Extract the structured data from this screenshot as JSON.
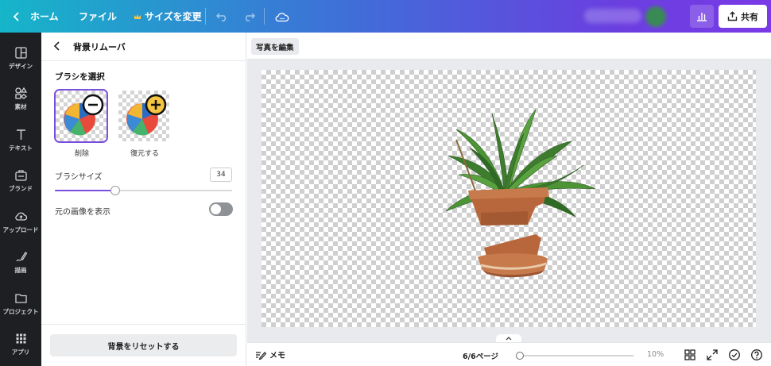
{
  "topbar": {
    "home_label": "ホーム",
    "file_label": "ファイル",
    "resize_label": "サイズを変更",
    "share_label": "共有"
  },
  "rail": {
    "items": [
      {
        "label": "デザイン",
        "icon": "layout-icon"
      },
      {
        "label": "素材",
        "icon": "shapes-icon"
      },
      {
        "label": "テキスト",
        "icon": "text-icon"
      },
      {
        "label": "ブランド",
        "icon": "brand-icon"
      },
      {
        "label": "アップロード",
        "icon": "upload-cloud-icon"
      },
      {
        "label": "描画",
        "icon": "draw-icon"
      },
      {
        "label": "プロジェクト",
        "icon": "folder-icon"
      },
      {
        "label": "アプリ",
        "icon": "apps-grid-icon"
      }
    ]
  },
  "panel": {
    "title": "背景リムーバ",
    "brush_section": "ブラシを選択",
    "brush_erase_label": "削除",
    "brush_restore_label": "復元する",
    "brush_size_label": "ブラシサイズ",
    "brush_size_value": "34",
    "brush_size_fraction": 0.34,
    "show_original_label": "元の画像を表示",
    "show_original_on": false,
    "reset_label": "背景をリセットする"
  },
  "canvas": {
    "edit_photo_label": "写真を編集"
  },
  "bottombar": {
    "memo_label": "メモ",
    "page_indicator": "6/6ページ",
    "zoom_value": "10%",
    "zoom_fraction": 0.0
  },
  "colors": {
    "accent": "#7b4ee0"
  }
}
